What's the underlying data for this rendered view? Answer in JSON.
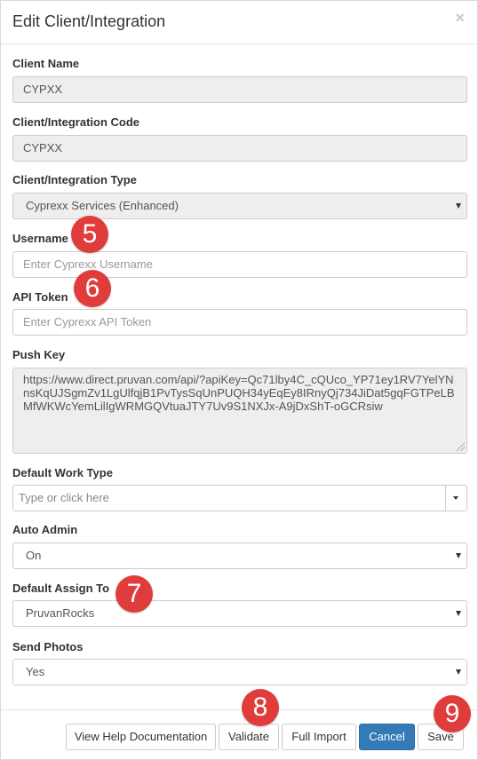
{
  "modal": {
    "title": "Edit Client/Integration",
    "close_symbol": "×"
  },
  "fields": {
    "client_name": {
      "label": "Client Name",
      "value": "CYPXX"
    },
    "client_code": {
      "label": "Client/Integration Code",
      "value": "CYPXX"
    },
    "client_type": {
      "label": "Client/Integration Type",
      "value": "Cyprexx Services (Enhanced)"
    },
    "username": {
      "label": "Username",
      "placeholder": "Enter Cyprexx Username"
    },
    "api_token": {
      "label": "API Token",
      "placeholder": "Enter Cyprexx API Token"
    },
    "push_key": {
      "label": "Push Key",
      "value": "https://www.direct.pruvan.com/api/?apiKey=Qc71lby4C_cQUco_YP71ey1RV7YelYNnsKqUJSgmZv1LgUlfqjB1PvTysSqUnPUQH34yEqEy8IRnyQj734JiDat5gqFGTPeLBMfWKWcYemLilIgWRMGQVtuaJTY7Uv9S1NXJx-A9jDxShT-oGCRsiw"
    },
    "default_work_type": {
      "label": "Default Work Type",
      "placeholder": "Type or click here"
    },
    "auto_admin": {
      "label": "Auto Admin",
      "value": "On"
    },
    "default_assign_to": {
      "label": "Default Assign To",
      "value": "PruvanRocks"
    },
    "send_photos": {
      "label": "Send Photos",
      "value": "Yes"
    }
  },
  "badges": {
    "b5": "5",
    "b6": "6",
    "b7": "7",
    "b8": "8",
    "b9": "9"
  },
  "footer": {
    "help_label": "View Help Documentation",
    "validate_label": "Validate",
    "full_import_label": "Full Import",
    "cancel_label": "Cancel",
    "save_label": "Save"
  },
  "colors": {
    "primary": "#337ab7",
    "badge": "#e03c3c",
    "readonly_bg": "#eeeeee"
  },
  "icons": {
    "close": "close-icon",
    "select_arrow": "chevron-down-icon",
    "resize": "resize-grip-icon"
  }
}
